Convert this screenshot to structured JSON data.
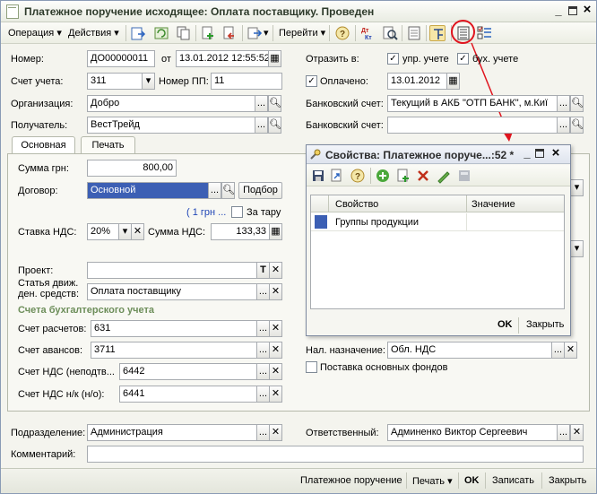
{
  "window": {
    "title": "Платежное поручение исходящее: Оплата поставщику. Проведен"
  },
  "toolbar": {
    "operation": "Операция ▾",
    "actions": "Действия ▾",
    "goto": "Перейти ▾"
  },
  "form": {
    "number_label": "Номер:",
    "number_value": "ДО00000011",
    "from_label": "от",
    "date_value": "13.01.2012 12:55:52",
    "reflect_label": "Отразить в:",
    "upr_label": "упр. учете",
    "buh_label": "бух. учете",
    "account_label": "Счет учета:",
    "account_value": "311",
    "pp_label": "Номер ПП:",
    "pp_value": "11",
    "paid_label": "Оплачено:",
    "paid_date": "13.01.2012",
    "org_label": "Организация:",
    "org_value": "Добро",
    "bank_label": "Банковский счет:",
    "bank_value": "Текущий в АКБ \"ОТП БАНК\", м.Киї",
    "recipient_label": "Получатель:",
    "recipient_value": "ВестТрейд",
    "bank2_label": "Банковский счет:",
    "bank2_value": ""
  },
  "tabs": {
    "main": "Основная",
    "print": "Печать"
  },
  "main": {
    "sum_label": "Сумма грн:",
    "sum_value": "800,00",
    "contract_label": "Договор:",
    "contract_value": "Основной",
    "select_btn": "Подбор",
    "rate_text": "( 1 грн ...",
    "tara_label": "За тару",
    "vat_rate_label": "Ставка НДС:",
    "vat_rate_value": "20%",
    "vat_sum_label": "Сумма НДС:",
    "vat_sum_value": "133,33",
    "project_label": "Проект:",
    "project_value": "",
    "article_label1": "Статья движ.",
    "article_label2": "ден. средств:",
    "article_value": "Оплата поставщику",
    "accounts_header": "Счета бухгалтерского учета",
    "calc_label": "Счет расчетов:",
    "calc_value": "631",
    "adv_label": "Счет авансов:",
    "adv_value": "3711",
    "vatnp_label": "Счет НДС (неподтв...",
    "vatnp_value": "6442",
    "vatnk_label": "Счет НДС н/к (н/о):",
    "vatnk_value": "6441",
    "tax_label": "Нал. назначение:",
    "tax_value": "Обл. НДС",
    "fixed_assets_label": "Поставка основных фондов"
  },
  "bottom": {
    "dept_label": "Подразделение:",
    "dept_value": "Администрация",
    "resp_label": "Ответственный:",
    "resp_value": "Админенко Виктор Сергеевич",
    "comment_label": "Комментарий:",
    "comment_value": ""
  },
  "footer": {
    "payment_order": "Платежное поручение",
    "print": "Печать ▾",
    "ok": "OK",
    "save": "Записать",
    "close": "Закрыть"
  },
  "dialog": {
    "title": "Свойства: Платежное поруче...:52 *",
    "col_property": "Свойство",
    "col_value": "Значение",
    "row1": "Группы продукции",
    "ok": "OK",
    "close": "Закрыть"
  },
  "colors": {
    "accent": "#e0141e",
    "selection": "#3c5fb4"
  }
}
